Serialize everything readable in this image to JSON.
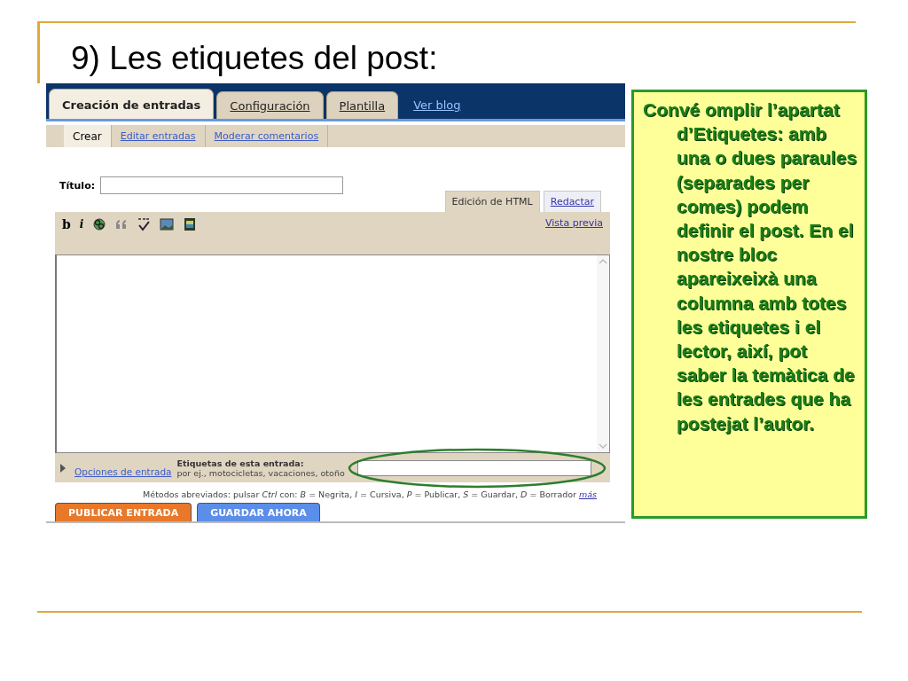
{
  "slide_title": "9) Les etiquetes del post:",
  "main_tabs": [
    {
      "label": "Creación de entradas",
      "selected": true,
      "kind": "tab"
    },
    {
      "label": "Configuración",
      "selected": false,
      "kind": "tab"
    },
    {
      "label": "Plantilla",
      "selected": false,
      "kind": "tab"
    },
    {
      "label": "Ver blog",
      "selected": false,
      "kind": "link"
    }
  ],
  "sub_tabs": [
    {
      "label": "Crear",
      "selected": true
    },
    {
      "label": "Editar entradas",
      "selected": false
    },
    {
      "label": "Moderar comentarios",
      "selected": false
    }
  ],
  "title_field": {
    "label": "Título:"
  },
  "editor_modes": [
    {
      "label": "Edición de HTML",
      "selected": true
    },
    {
      "label": "Redactar",
      "selected": false
    }
  ],
  "toolbar": {
    "buttons": [
      {
        "kind": "bold",
        "label": "b"
      },
      {
        "kind": "italic",
        "label": "i"
      },
      {
        "kind": "link"
      },
      {
        "kind": "quote"
      },
      {
        "kind": "spellcheck"
      },
      {
        "kind": "image"
      },
      {
        "kind": "video"
      }
    ],
    "preview_link": "Vista previa"
  },
  "labels": {
    "options_link": "Opciones de entrada",
    "label": "Etiquetas de esta entrada:",
    "hint": "por ej., motocicletas, vacaciones, otoño",
    "highlighted": true
  },
  "shortcuts": {
    "text": "Métodos abreviados: pulsar *Ctrl* con: *B* = Negrita, *I* = Cursiva, *P* = Publicar, *S* = Guardar, *D* = Borrador",
    "more_link": "más"
  },
  "buttons": [
    {
      "label": "PUBLICAR ENTRADA",
      "kind": "publish"
    },
    {
      "label": "GUARDAR AHORA",
      "kind": "save"
    }
  ],
  "callout": "Convé omplir l’apartat d’Etiquetes: amb una o dues paraules (separades per comes)  podem definir el post. En el nostre bloc apareixeixà una columna amb totes les etiquetes i el lector, així, pot saber la temàtica de les entrades que ha postejat l’autor."
}
